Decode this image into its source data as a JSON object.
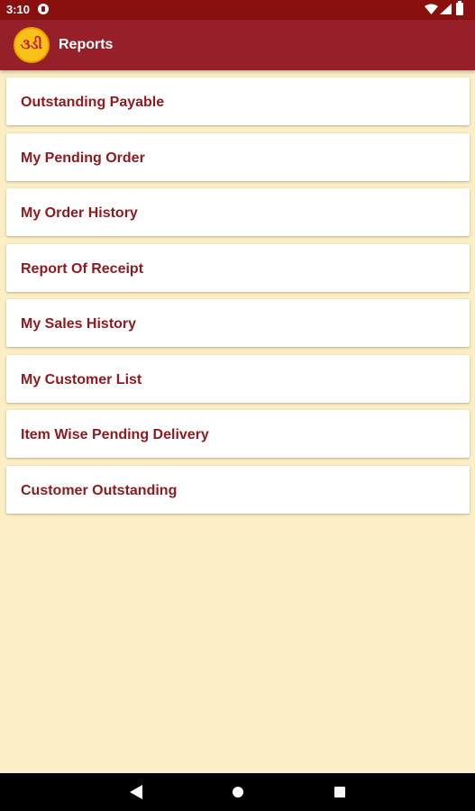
{
  "status_bar": {
    "time": "3:10",
    "icons": [
      "app-notification-icon",
      "wifi-icon",
      "signal-icon",
      "battery-icon"
    ]
  },
  "app_bar": {
    "title": "Reports",
    "logo_text": "૩ડી",
    "color": "#96202a"
  },
  "menu": {
    "items": [
      {
        "label": "Outstanding Payable"
      },
      {
        "label": "My Pending Order"
      },
      {
        "label": "My Order History"
      },
      {
        "label": "Report Of Receipt"
      },
      {
        "label": "My Sales History"
      },
      {
        "label": "My Customer List"
      },
      {
        "label": "Item Wise Pending Delivery"
      },
      {
        "label": "Customer Outstanding"
      }
    ]
  },
  "nav_bar": {
    "icons": [
      "back-icon",
      "home-icon",
      "recent-apps-icon"
    ]
  },
  "colors": {
    "status_bar": "#8a1010",
    "app_bar": "#96202a",
    "background": "#fdefc5",
    "item_text": "#8e1a1f"
  }
}
